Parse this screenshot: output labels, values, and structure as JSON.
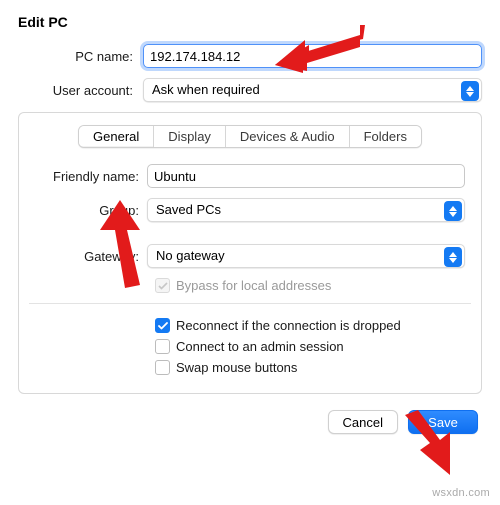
{
  "title": "Edit PC",
  "labels": {
    "pc_name": "PC name:",
    "user_account": "User account:",
    "friendly_name": "Friendly name:",
    "group": "Group:",
    "gateway": "Gateway:"
  },
  "fields": {
    "pc_name": "192.174.184.12",
    "user_account": "Ask when required",
    "friendly_name": "Ubuntu",
    "group": "Saved PCs",
    "gateway": "No gateway"
  },
  "tabs": {
    "general": "General",
    "display": "Display",
    "devices": "Devices & Audio",
    "folders": "Folders"
  },
  "checkboxes": {
    "bypass": "Bypass for local addresses",
    "reconnect": "Reconnect if the connection is dropped",
    "admin": "Connect to an admin session",
    "swap": "Swap mouse buttons"
  },
  "buttons": {
    "cancel": "Cancel",
    "save": "Save"
  },
  "watermark": "wsxdn.com"
}
